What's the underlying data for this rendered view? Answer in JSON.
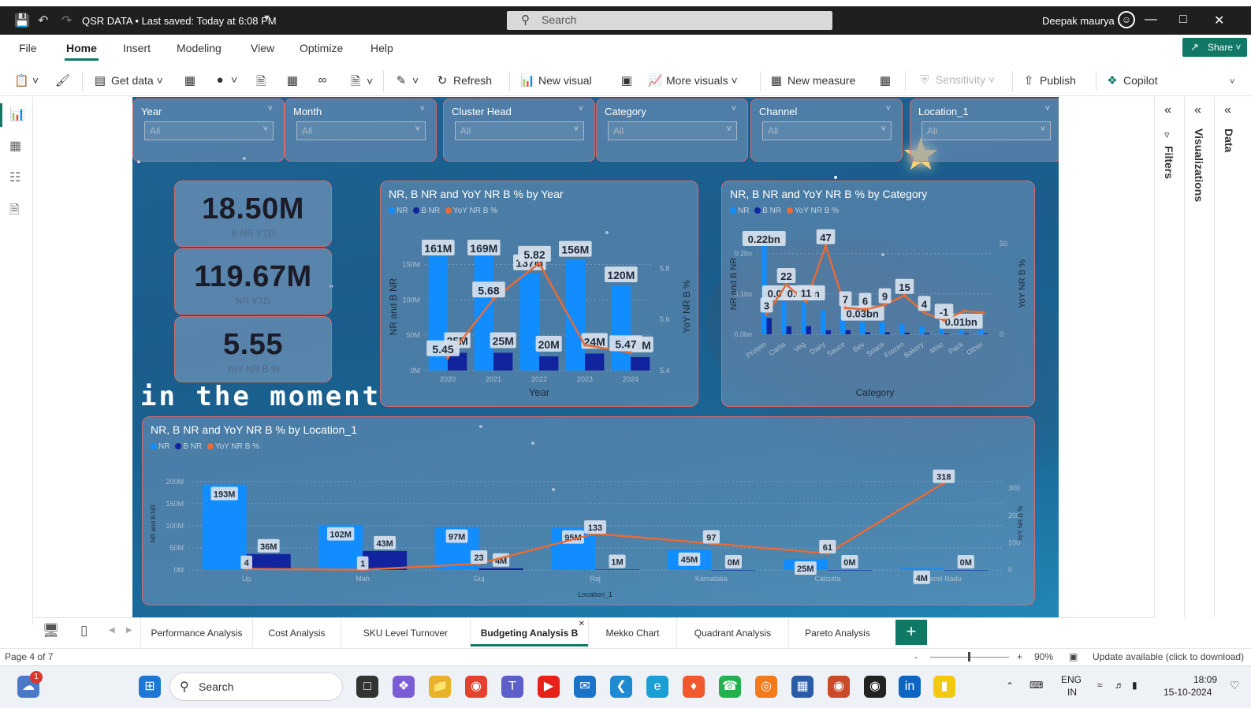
{
  "titlebar": {
    "doc_title": "QSR DATA • Last saved: Today at 6:08 PM",
    "search_placeholder": "Search",
    "user_name": "Deepak maurya"
  },
  "menu": {
    "items": [
      "File",
      "Home",
      "Insert",
      "Modeling",
      "View",
      "Optimize",
      "Help"
    ],
    "active": "Home",
    "share_label": "Share"
  },
  "ribbon": {
    "get_data": "Get data",
    "refresh": "Refresh",
    "new_visual": "New visual",
    "more_visuals": "More visuals",
    "new_measure": "New measure",
    "sensitivity": "Sensitivity",
    "publish": "Publish",
    "copilot": "Copilot"
  },
  "slicers": [
    {
      "label": "Year",
      "value": "All"
    },
    {
      "label": "Month",
      "value": "All"
    },
    {
      "label": "Cluster Head",
      "value": "All"
    },
    {
      "label": "Category",
      "value": "All"
    },
    {
      "label": "Channel",
      "value": "All"
    },
    {
      "label": "Location_1",
      "value": "All"
    }
  ],
  "cards": [
    {
      "value": "18.50M",
      "label": "B NR YTD"
    },
    {
      "value": "119.67M",
      "label": "NR YTD"
    },
    {
      "value": "5.55",
      "label": "YoY NR B %"
    }
  ],
  "overlay_text": "in the moment",
  "legend": {
    "nr": "NR",
    "bnr": "B NR",
    "yoy": "YoY NR B %"
  },
  "colors": {
    "nr": "#118dff",
    "bnr": "#12239e",
    "yoy": "#e66c37",
    "accent": "#117865"
  },
  "chart_data": [
    {
      "type": "bar",
      "title": "NR, B NR and YoY NR B % by Year",
      "xlabel": "Year",
      "ylabel": "NR and B NR",
      "y2label": "YoY NR B %",
      "categories": [
        "2020",
        "2021",
        "2022",
        "2023",
        "2024"
      ],
      "series": [
        {
          "name": "NR",
          "values": [
            161,
            169,
            137,
            156,
            120
          ],
          "labels": [
            "161M",
            "169M",
            "137M",
            "156M",
            "120M"
          ]
        },
        {
          "name": "B NR",
          "values": [
            25,
            25,
            20,
            24,
            19
          ],
          "labels": [
            "25M",
            "25M",
            "20M",
            "24M",
            "19M"
          ]
        },
        {
          "name": "YoY NR B %",
          "values": [
            5.45,
            5.68,
            5.82,
            5.5,
            5.47
          ],
          "labels": [
            "5.45",
            "5.68",
            "5.82",
            "",
            "5.47"
          ]
        }
      ],
      "yticks": [
        "0M",
        "50M",
        "100M",
        "150M"
      ],
      "y2ticks": [
        "5.4",
        "5.6",
        "5.8"
      ],
      "ylim": [
        0,
        180
      ],
      "y2lim": [
        5.4,
        5.9
      ]
    },
    {
      "type": "bar",
      "title": "NR, B NR and YoY NR B % by Category",
      "xlabel": "Category",
      "ylabel": "NR and B NR",
      "y2label": "YoY NR B %",
      "categories": [
        "Protein",
        "Carbs",
        "Veg",
        "Dairy",
        "Sauce",
        "Bev",
        "Snack",
        "Frozen",
        "Bakery",
        "Misc",
        "Pack",
        "Other"
      ],
      "series": [
        {
          "name": "NR",
          "values": [
            0.22,
            0.08,
            0.08,
            0.06,
            0.05,
            0.03,
            0.03,
            0.025,
            0.02,
            0.015,
            0.01,
            0.01
          ],
          "labels": [
            "0.22bn",
            "0.08bn",
            "0.08bn",
            "",
            "",
            "0.03bn",
            "",
            "",
            "",
            "",
            "0.01bn",
            ""
          ]
        },
        {
          "name": "B NR",
          "values": [
            0.04,
            0.02,
            0.02,
            0.01,
            0.01,
            0.005,
            0.005,
            0.004,
            0.003,
            0.002,
            0.002,
            0.002
          ]
        },
        {
          "name": "YoY NR B %",
          "values": [
            3,
            22,
            11,
            47,
            7,
            6,
            9,
            15,
            4,
            -1,
            5,
            4
          ],
          "labels": [
            "3",
            "22",
            "11",
            "47",
            "7",
            "6",
            "9",
            "15",
            "4",
            "-1",
            "",
            ""
          ]
        }
      ],
      "yticks": [
        "0.0bn",
        "0.1bn",
        "0.2bn"
      ],
      "y2ticks": [
        "0",
        "50"
      ],
      "ylim": [
        0,
        0.25
      ],
      "y2lim": [
        -10,
        55
      ]
    },
    {
      "type": "bar",
      "title": "NR, B NR and YoY NR B % by Location_1",
      "xlabel": "Location_1",
      "ylabel": "NR and B NR",
      "y2label": "YoY NR B %",
      "categories": [
        "Up",
        "Mah",
        "Guj",
        "Raj",
        "Karnataka",
        "Calcutta",
        "Tamil Nadu"
      ],
      "series": [
        {
          "name": "NR",
          "values": [
            193,
            102,
            97,
            95,
            45,
            25,
            4
          ],
          "labels": [
            "193M",
            "102M",
            "97M",
            "95M",
            "45M",
            "25M",
            "4M"
          ]
        },
        {
          "name": "B NR",
          "values": [
            36,
            43,
            4,
            1,
            0,
            0,
            0
          ],
          "labels": [
            "36M",
            "43M",
            "4M",
            "1M",
            "0M",
            "0M",
            "0M"
          ]
        },
        {
          "name": "YoY NR B %",
          "values": [
            4,
            1,
            23,
            133,
            97,
            61,
            318
          ],
          "labels": [
            "4",
            "1",
            "23",
            "133",
            "97",
            "61",
            "318"
          ]
        }
      ],
      "yticks": [
        "0M",
        "50M",
        "100M",
        "150M",
        "200M"
      ],
      "y2ticks": [
        "0",
        "100",
        "200",
        "300"
      ],
      "ylim": [
        0,
        210
      ],
      "y2lim": [
        0,
        340
      ]
    }
  ],
  "page_tabs": [
    "Performance Analysis",
    "Cost Analysis",
    "SKU Level Turnover",
    "Budgeting Analysis B",
    "Mekko Chart",
    "Quadrant Analysis",
    "Pareto Analysis"
  ],
  "active_tab": "Budgeting Analysis B",
  "panes": {
    "filters": "Filters",
    "visualizations": "Visualizations",
    "data": "Data"
  },
  "status": {
    "page": "Page 4 of 7",
    "zoom": "90%",
    "update": "Update available (click to download)"
  },
  "taskbar": {
    "search": "Search",
    "lang": "ENG",
    "region": "IN",
    "time": "18:09",
    "date": "15-10-2024",
    "notifications": "1"
  }
}
